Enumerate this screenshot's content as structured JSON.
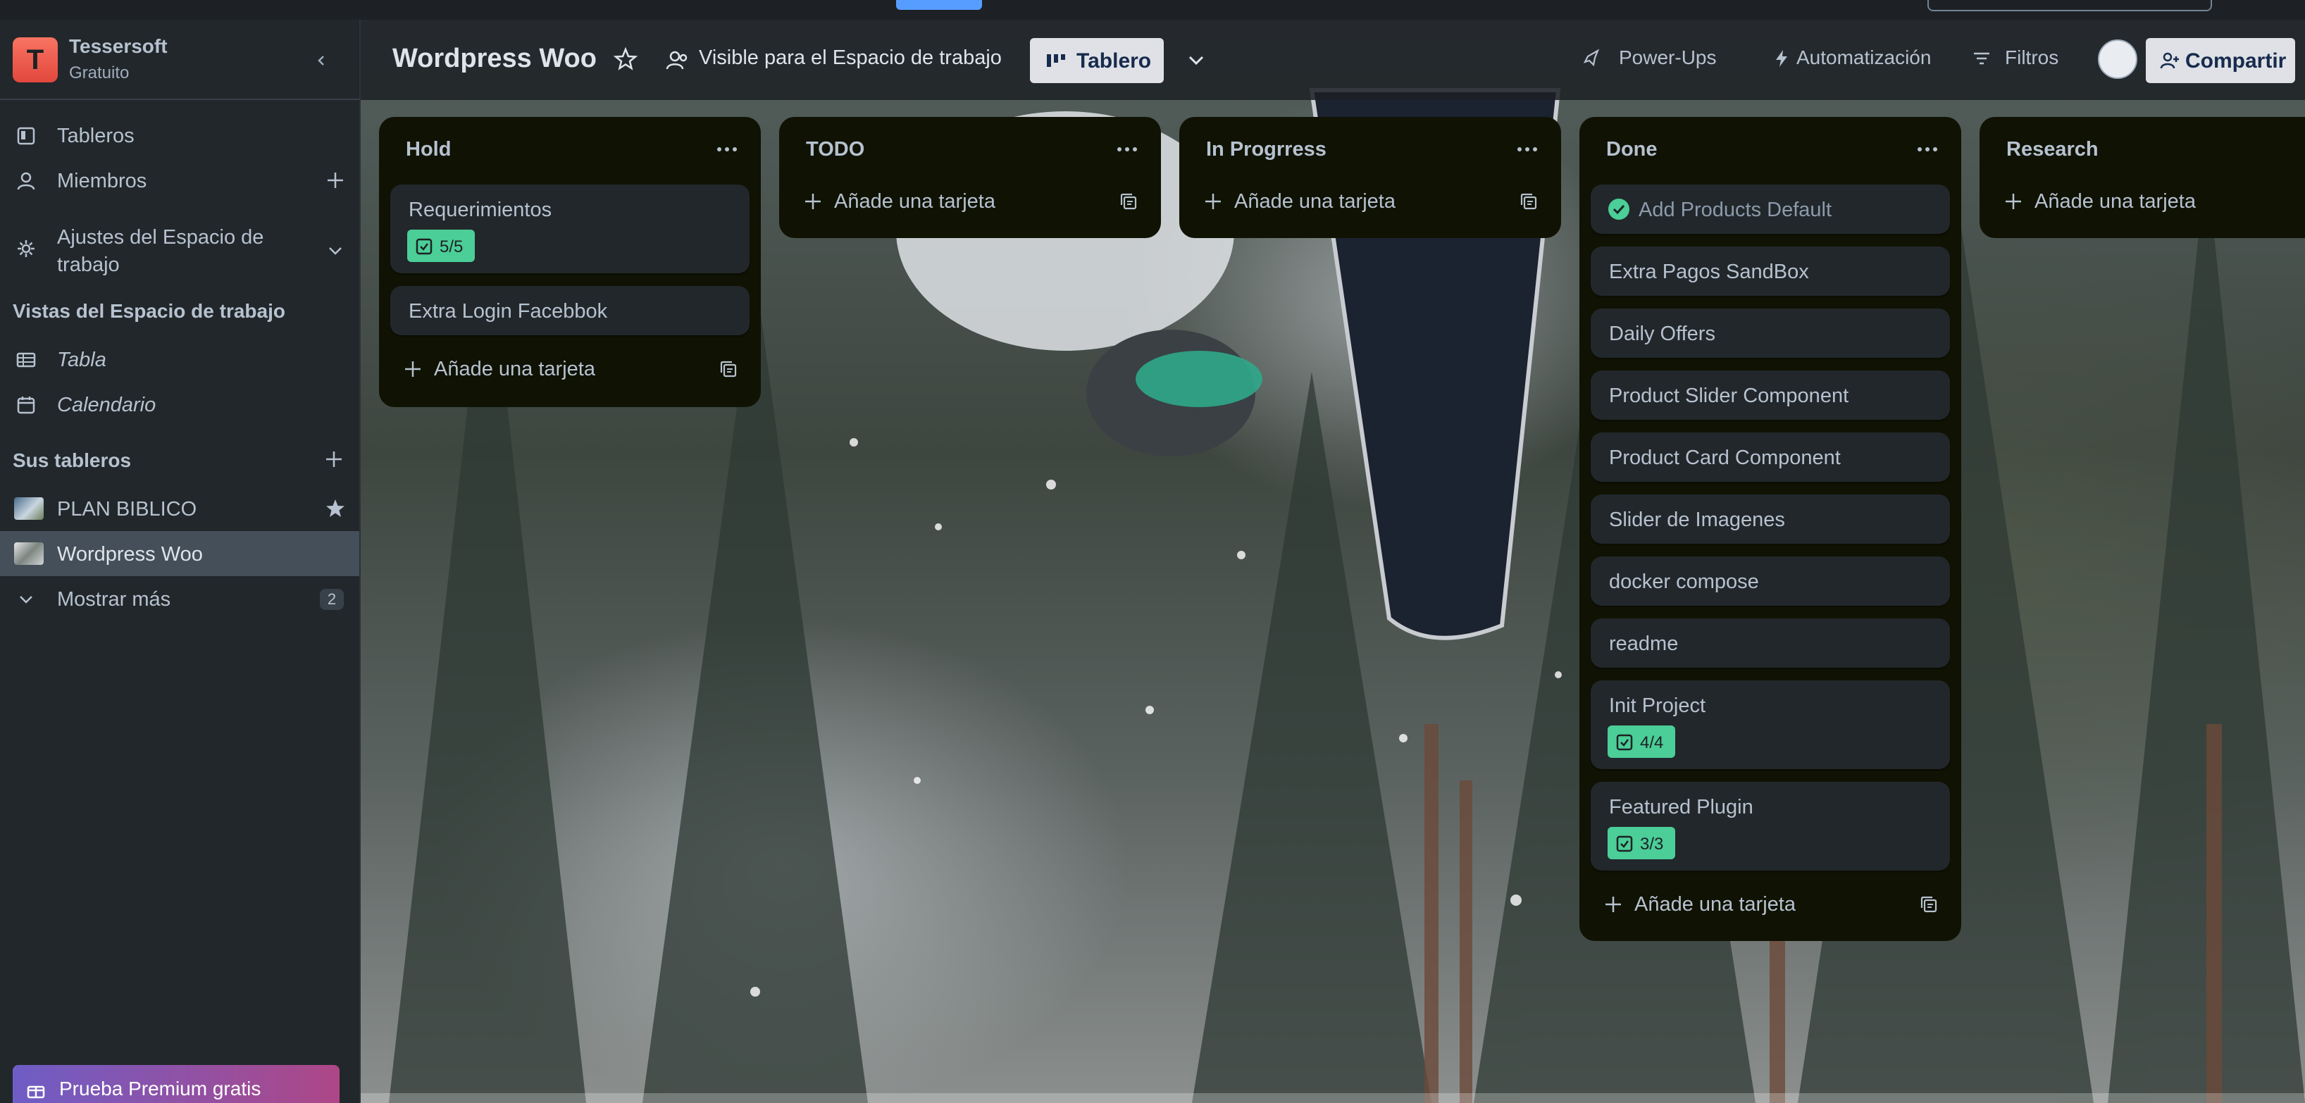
{
  "sidebar": {
    "workspace": {
      "initial": "T",
      "name": "Tessersoft",
      "plan": "Gratuito"
    },
    "nav": [
      {
        "label": "Tableros",
        "icon": "board-icon"
      },
      {
        "label": "Miembros",
        "icon": "member-icon"
      },
      {
        "label": "Ajustes del Espacio de trabajo",
        "icon": "gear-icon"
      }
    ],
    "views_heading": "Vistas del Espacio de trabajo",
    "views": [
      {
        "label": "Tabla",
        "icon": "table-icon"
      },
      {
        "label": "Calendario",
        "icon": "calendar-icon"
      }
    ],
    "boards_heading": "Sus tableros",
    "boards": [
      {
        "label": "PLAN BIBLICO",
        "starred": true
      },
      {
        "label": "Wordpress Woo",
        "active": true
      }
    ],
    "show_more": {
      "label": "Mostrar más",
      "count": "2"
    },
    "premium_label": "Prueba Premium gratis"
  },
  "board": {
    "title": "Wordpress Woo",
    "visibility": "Visible para el Espacio de trabajo",
    "view": "Tablero",
    "powerups": "Power-Ups",
    "automation": "Automatización",
    "filters": "Filtros",
    "share": "Compartir"
  },
  "add_card_label": "Añade una tarjeta",
  "lists": [
    {
      "title": "Hold",
      "cards": [
        {
          "text": "Requerimientos",
          "checklist": "5/5"
        },
        {
          "text": "Extra Login Facebbok"
        }
      ]
    },
    {
      "title": "TODO",
      "cards": []
    },
    {
      "title": "In Progrress",
      "cards": []
    },
    {
      "title": "Done",
      "cards": [
        {
          "text": "Add Products Default",
          "complete": true
        },
        {
          "text": "Extra Pagos SandBox"
        },
        {
          "text": "Daily Offers"
        },
        {
          "text": "Product Slider Component"
        },
        {
          "text": "Product Card Component"
        },
        {
          "text": "Slider de Imagenes"
        },
        {
          "text": "docker compose"
        },
        {
          "text": "readme"
        },
        {
          "text": "Init Project",
          "checklist": "4/4"
        },
        {
          "text": "Featured Plugin",
          "checklist": "3/3"
        }
      ]
    },
    {
      "title": "Research",
      "cards": []
    }
  ],
  "colors": {
    "accent": "#579dff",
    "list_bg": "#101204",
    "card_bg": "#22272b",
    "checklist_complete": "#4bce97"
  }
}
